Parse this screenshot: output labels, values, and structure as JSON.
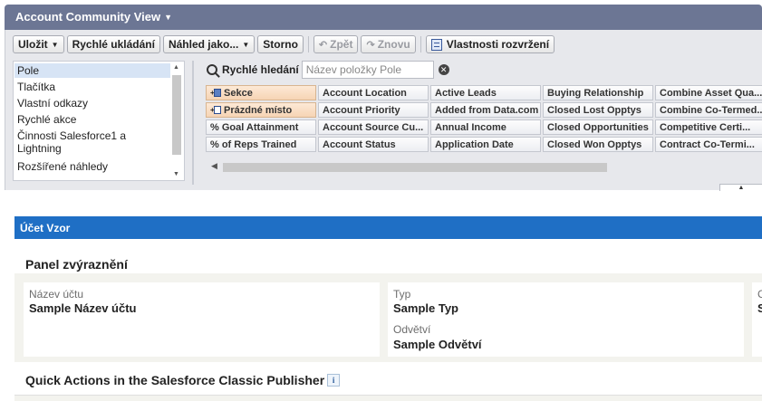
{
  "header": {
    "title": "Account Community View"
  },
  "toolbar": {
    "save": "Uložit",
    "quick_save": "Rychlé ukládání",
    "preview_as": "Náhled jako...",
    "cancel": "Storno",
    "undo": "Zpět",
    "redo": "Znovu",
    "layout_properties": "Vlastnosti rozvržení"
  },
  "palette": {
    "categories": [
      {
        "label": "Pole",
        "selected": true
      },
      {
        "label": "Tlačítka",
        "selected": false
      },
      {
        "label": "Vlastní odkazy",
        "selected": false
      },
      {
        "label": "Rychlé akce",
        "selected": false
      },
      {
        "label": "Činnosti Salesforce1 a Lightning",
        "selected": false
      },
      {
        "label": "Rozšířené náhledy",
        "selected": false
      }
    ],
    "search": {
      "label": "Rychlé hledání",
      "placeholder": "Název položky Pole"
    },
    "fields": [
      [
        "Sekce",
        "Account Location",
        "Active Leads",
        "Buying Relationship",
        "Combine Asset Qua..."
      ],
      [
        "Prázdné místo",
        "Account Priority",
        "Added from Data.com",
        "Closed Lost Opptys",
        "Combine Co-Termed..."
      ],
      [
        "% Goal Attainment",
        "Account Source Cu...",
        "Annual Income",
        "Closed Opportunities",
        "Competitive Certi..."
      ],
      [
        "% of Reps Trained",
        "Account Status",
        "Application Date",
        "Closed Won Opptys",
        "Contract Co-Termi..."
      ]
    ]
  },
  "preview": {
    "record_title": "Účet Vzor",
    "highlights_title": "Panel zvýraznění",
    "highlights": {
      "col1": {
        "label": "Název účtu",
        "value": "Sample Název účtu"
      },
      "col2a": {
        "label": "Typ",
        "value": "Sample Typ"
      },
      "col2b": {
        "label": "Odvětví",
        "value": "Sample Odvětví"
      },
      "col3": {
        "label": "C",
        "value": "S"
      }
    },
    "quick_actions_title": "Quick Actions in the Salesforce Classic Publisher",
    "info_icon_text": "i"
  }
}
